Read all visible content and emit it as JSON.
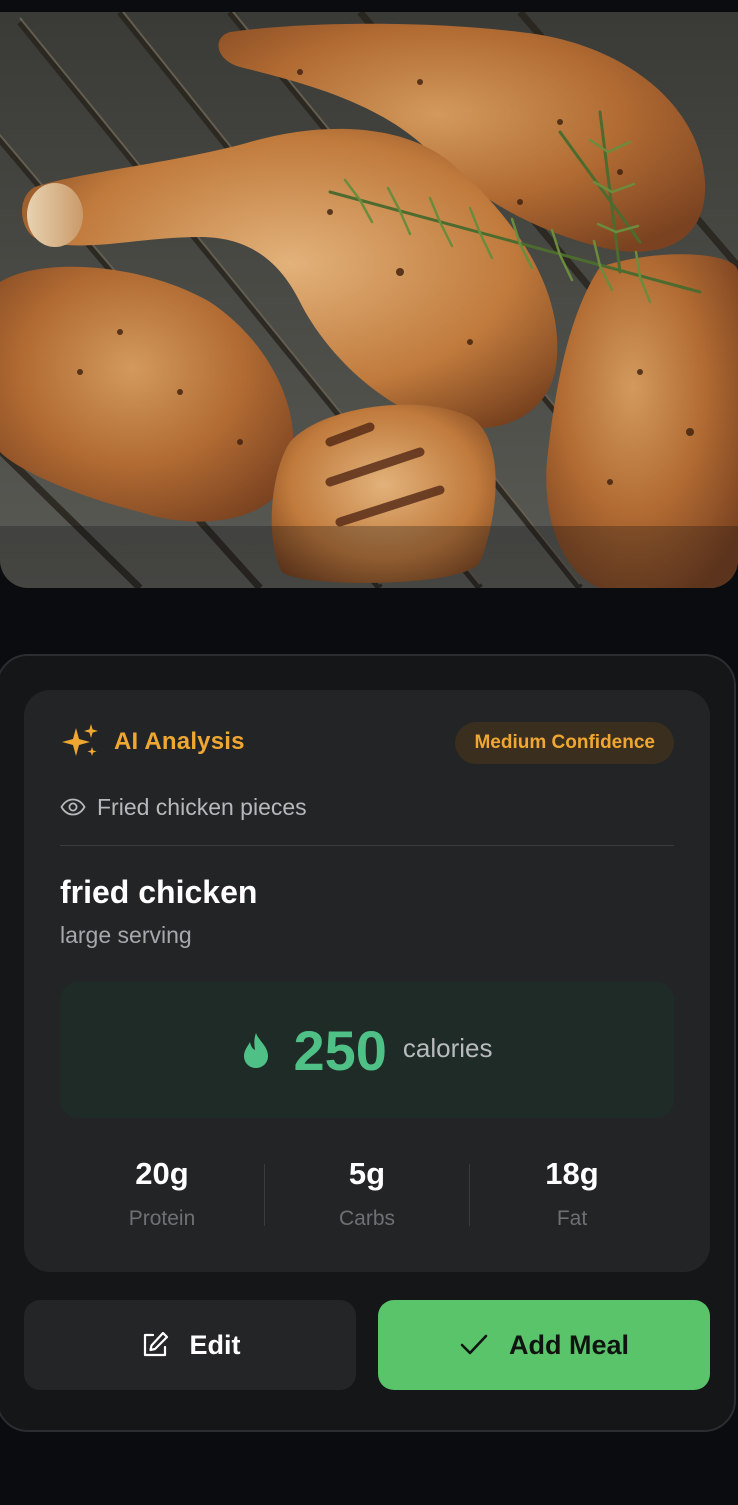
{
  "photo": {
    "subject": "grilled chicken pieces with rosemary on grill grate"
  },
  "analysis": {
    "title": "AI Analysis",
    "icon": "sparkle-icon",
    "confidence_badge": "Medium Confidence",
    "detected_label": "Fried chicken pieces",
    "detected_icon": "eye-icon",
    "food_name": "fried chicken",
    "serving": "large serving",
    "calories": {
      "value": "250",
      "unit": "calories",
      "icon": "flame-icon"
    },
    "macros": [
      {
        "value": "20g",
        "label": "Protein"
      },
      {
        "value": "5g",
        "label": "Carbs"
      },
      {
        "value": "18g",
        "label": "Fat"
      }
    ]
  },
  "actions": {
    "edit_label": "Edit",
    "edit_icon": "edit-icon",
    "add_label": "Add Meal",
    "add_icon": "check-icon"
  },
  "colors": {
    "accent_orange": "#f0a732",
    "calorie_green": "#4fc187",
    "add_button_green": "#59c46a",
    "background": "#0b0c0f",
    "card": "#232426"
  }
}
